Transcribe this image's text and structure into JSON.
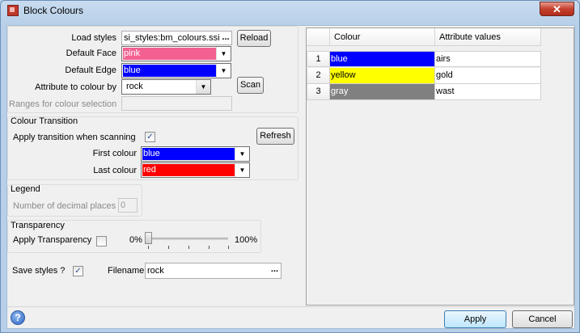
{
  "window": {
    "title": "Block Colours",
    "close_label": "✕"
  },
  "form": {
    "load_styles": {
      "label": "Load styles",
      "value": "si_styles:bm_colours.ssi",
      "browse_label": "...",
      "reload_label": "Reload"
    },
    "default_face": {
      "label": "Default Face",
      "value": "pink",
      "color": "#f26191"
    },
    "default_edge": {
      "label": "Default Edge",
      "value": "blue",
      "color": "#0000ff"
    },
    "attribute": {
      "label": "Attribute to colour by",
      "value": "rock",
      "scan_label": "Scan"
    },
    "ranges": {
      "label": "Ranges for colour selection",
      "value": ""
    }
  },
  "transition": {
    "title": "Colour Transition",
    "apply_label": "Apply transition when scanning",
    "apply_checked": true,
    "refresh_label": "Refresh",
    "first_label": "First colour",
    "first_value": "blue",
    "first_color": "#0000ff",
    "last_label": "Last colour",
    "last_value": "red",
    "last_color": "#ff0000"
  },
  "legend": {
    "title": "Legend",
    "decimal_label": "Number of decimal places",
    "decimal_value": "0"
  },
  "transparency": {
    "title": "Transparency",
    "apply_label": "Apply Transparency",
    "apply_checked": false,
    "min_label": "0%",
    "max_label": "100%",
    "value_percent": 0
  },
  "save": {
    "label": "Save styles ?",
    "checked": true,
    "filename_label": "Filename",
    "filename_value": "rock",
    "browse_label": "..."
  },
  "table": {
    "columns": [
      "Colour",
      "Attribute values"
    ],
    "rows": [
      {
        "index": "1",
        "colour": "blue",
        "color": "#0000ff",
        "text_color": "#ffffff",
        "value": "airs"
      },
      {
        "index": "2",
        "colour": "yellow",
        "color": "#ffff00",
        "text_color": "#000000",
        "value": "gold"
      },
      {
        "index": "3",
        "colour": "gray",
        "color": "#808080",
        "text_color": "#ffffff",
        "value": "wast"
      }
    ]
  },
  "footer": {
    "help_label": "?",
    "apply_label": "Apply",
    "cancel_label": "Cancel"
  }
}
